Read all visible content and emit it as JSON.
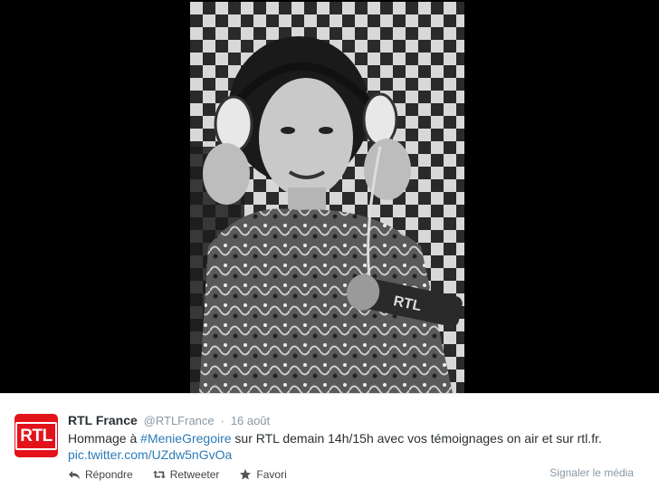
{
  "photo": {
    "description_icon": "portrait-photo",
    "mic_logo_text": "RTL"
  },
  "tweet": {
    "avatar_text": "RTL",
    "fullname": "RTL France",
    "username": "@RTLFrance",
    "separator": "·",
    "timestamp": "16 août",
    "text_before": "Hommage à ",
    "hashtag": "#MenieGregoire",
    "text_after": " sur RTL demain 14h/15h avec vos témoignages on air et sur rtl.fr.",
    "pic_link": "pic.twitter.com/UZdw5nGvOa"
  },
  "actions": {
    "reply_label": "Répondre",
    "retweet_label": "Retweeter",
    "favorite_label": "Favori",
    "report_label": "Signaler le média"
  },
  "colors": {
    "brand_red": "#e3131b",
    "link_blue": "#2b7bb9",
    "muted": "#8899a6"
  }
}
